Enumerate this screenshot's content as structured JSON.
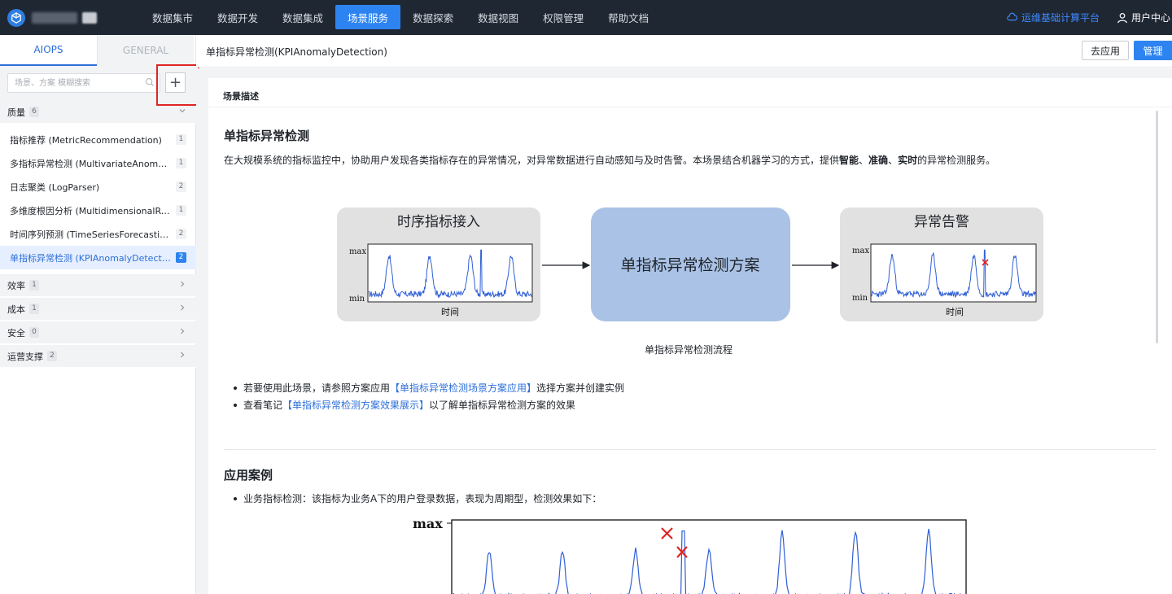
{
  "topbar": {
    "nav": [
      "数据集市",
      "数据开发",
      "数据集成",
      "场景服务",
      "数据探索",
      "数据视图",
      "权限管理",
      "帮助文档"
    ],
    "active_nav": "场景服务",
    "platform": "运维基础计算平台",
    "user": "用户中心"
  },
  "sidebar": {
    "tabs": [
      "AIOPS",
      "GENERAL"
    ],
    "search_placeholder": "场景、方案 模糊搜索",
    "add_label": "+",
    "groups": [
      {
        "label": "质量",
        "count": "6"
      },
      {
        "label": "效率",
        "count": "1"
      },
      {
        "label": "成本",
        "count": "1"
      },
      {
        "label": "安全",
        "count": "0"
      },
      {
        "label": "运营支撑",
        "count": "2"
      }
    ],
    "items": [
      {
        "label": "指标推荐 (MetricRecommendation)",
        "count": "1"
      },
      {
        "label": "多指标异常检测 (MultivariateAnomalyDetection)",
        "count": "1"
      },
      {
        "label": "日志聚类 (LogParser)",
        "count": "2"
      },
      {
        "label": "多维度根因分析 (MultidimensionalRootCauseAnalysis)",
        "count": "1"
      },
      {
        "label": "时间序列预测 (TimeSeriesForecasting)",
        "count": "2"
      },
      {
        "label": "单指标异常检测 (KPIAnomalyDetection)",
        "count": "2"
      }
    ]
  },
  "main": {
    "title": "单指标异常检测(KPIAnomalyDetection)",
    "apply_button": "去应用",
    "manage_button": "管理",
    "section_label": "场景描述",
    "heading": "单指标异常检测",
    "desc_prefix": "在大规模系统的指标监控中，协助用户发现各类指标存在的异常情况，对异常数据进行自动感知与及时告警。本场景结合机器学习的方式，提供",
    "desc_b1": "智能",
    "desc_sep1": "、",
    "desc_b2": "准确",
    "desc_sep2": "、",
    "desc_b3": "实时",
    "desc_suffix": "的异常检测服务。",
    "diagram": {
      "box1_title": "时序指标接入",
      "box2_title": "单指标异常检测方案",
      "box3_title": "异常告警",
      "ymax": "max",
      "ymin": "min",
      "xlabel": "时间",
      "caption": "单指标异常检测流程"
    },
    "bullet1_prefix": "若要使用此场景，请参照方案应用",
    "bullet1_link": "【单指标异常检测场景方案应用】",
    "bullet1_suffix": "选择方案并创建实例",
    "bullet2_prefix": "查看笔记",
    "bullet2_link": "【单指标异常检测方案效果展示】",
    "bullet2_suffix": "以了解单指标异常检测方案的效果",
    "heading2": "应用案例",
    "case_text": "业务指标检测：该指标为业务A下的用户登录数据，表现为周期型，检测效果如下：",
    "case_chart_ymax": "max"
  },
  "colors": {
    "topbar_bg": "#1f2733",
    "accent": "#2d84f0",
    "anomaly": "#e02424",
    "series": "#2f5fd6",
    "center_box": "#a9c2e5"
  }
}
